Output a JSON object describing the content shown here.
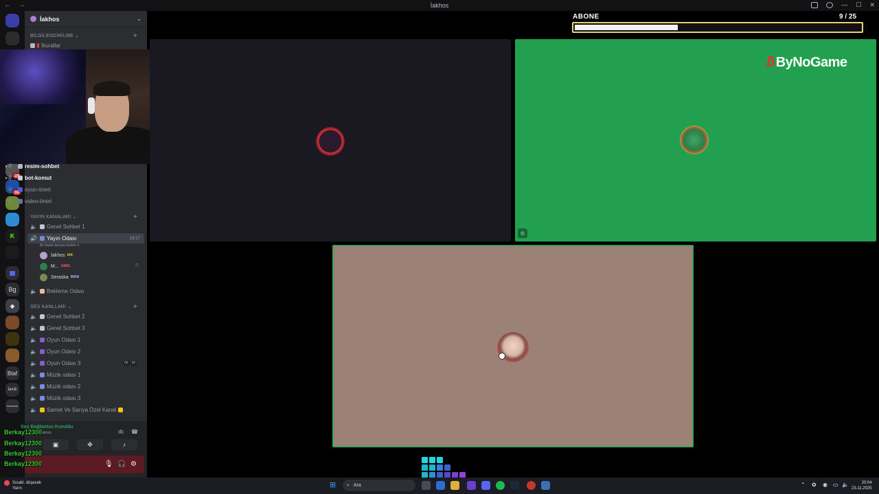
{
  "window": {
    "title": "İakhos",
    "back": "←",
    "forward": "→",
    "minimize": "—",
    "maximize": "☐",
    "close": "✕"
  },
  "rail": {
    "badges": [
      "24",
      "98"
    ],
    "labels": [
      "Bg",
      "Btaf",
      "İavdı",
      "ᴮᴼᴿᴬᴰᴬᴹᴵᴺ"
    ]
  },
  "server": {
    "name": "İakhos",
    "chevron": "⌄"
  },
  "categories": {
    "bilgilendirme": "BİLGİLENDİRİLME",
    "yayin": "YAYIN KANALARI",
    "ses": "SES KANLLARI"
  },
  "channels": {
    "kurallar": "İkurallar",
    "resim": "resim-sohbet",
    "bot": "bot-komut",
    "oyun_oneri": "oyun-öneri",
    "video_oneri": "video-öneri",
    "genel1": "Genel Sohbet 1",
    "yayin_odasi": "Yayın Odası",
    "yayin_time": "19:17",
    "yayin_sub": "Bir kanal durumu belirle ✎",
    "bekleme": "Bekleme Odası",
    "genel2": "Genel Sohbet 2",
    "genel3": "Genel Sohbet 3",
    "oyun1": "Oyun Odası 1",
    "oyun2": "Oyun Odası 2",
    "oyun3": "Oyun Odası 3",
    "oyun3_pill1": "00",
    "oyun3_pill2": "02",
    "muzik1": "Müzik odası 1",
    "muzik2": "Müzik odası 2",
    "muzik3": "Müzik odası 3",
    "ozel": "Samet Ve Sarıya Özel Kanal"
  },
  "voice_users": [
    {
      "name": "İakhos",
      "tag": "IAK",
      "color": "#b5a0d0"
    },
    {
      "name": "M...",
      "tag": "GNDL",
      "color": "#2e7d4b"
    },
    {
      "name": "Seraska",
      "tag": "BMW",
      "color": "#7a8c50"
    }
  ],
  "voice_panel": {
    "status": "Ses Bağlantısı Kuruldu",
    "sub": "İakhos",
    "signal": "ıllı",
    "hangup": "☎"
  },
  "followers": [
    "Berkay12300",
    "Berkay12300",
    "Berkay12300",
    "Berkay12300"
  ],
  "stage": {
    "logo_brand": "ByNoGame",
    "logo_mark": "ƃ"
  },
  "sub_goal": {
    "label": "ABONE",
    "count": "9 / 25",
    "progress": 0.36
  },
  "taskbar": {
    "weather_title": "Sıcakl. düşecek",
    "weather_sub": "Yarın",
    "search": "Ara",
    "time": "20:04",
    "date": "23.11.2025",
    "tray": "⌃"
  },
  "colors": {
    "accent_green": "#23a04f",
    "follower_green": "#3ccc34",
    "goal_border": "#e6d37a",
    "brand_red": "#e2342c"
  }
}
